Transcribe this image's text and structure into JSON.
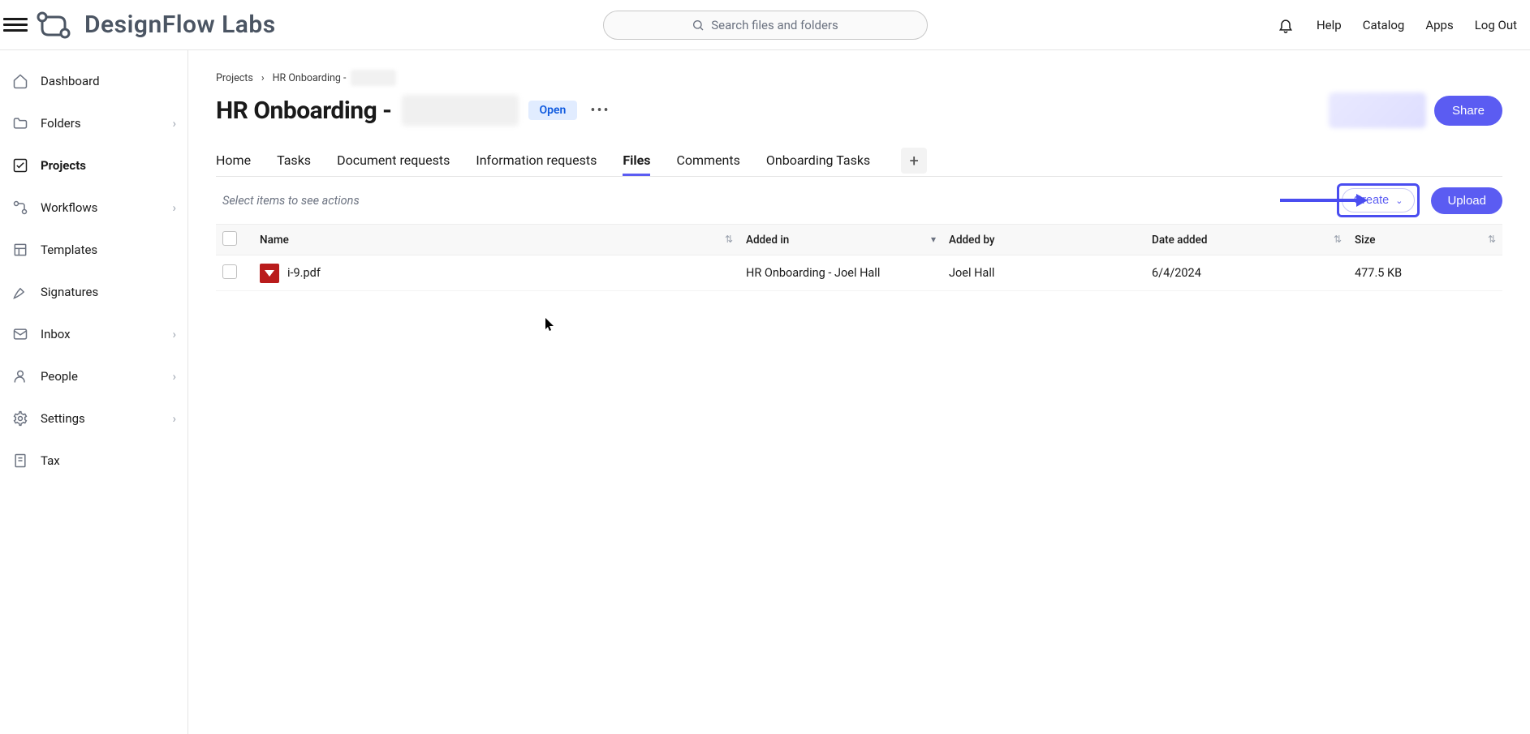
{
  "brand": {
    "name": "DesignFlow Labs"
  },
  "search": {
    "placeholder": "Search files and folders"
  },
  "topnav": {
    "help": "Help",
    "catalog": "Catalog",
    "apps": "Apps",
    "logout": "Log Out"
  },
  "sidebar": {
    "items": [
      {
        "label": "Dashboard",
        "has_chevron": false
      },
      {
        "label": "Folders",
        "has_chevron": true
      },
      {
        "label": "Projects",
        "has_chevron": false
      },
      {
        "label": "Workflows",
        "has_chevron": true
      },
      {
        "label": "Templates",
        "has_chevron": false
      },
      {
        "label": "Signatures",
        "has_chevron": false
      },
      {
        "label": "Inbox",
        "has_chevron": true
      },
      {
        "label": "People",
        "has_chevron": true
      },
      {
        "label": "Settings",
        "has_chevron": true
      },
      {
        "label": "Tax",
        "has_chevron": false
      }
    ],
    "active_index": 2
  },
  "breadcrumb": {
    "root": "Projects",
    "current": "HR Onboarding -"
  },
  "header": {
    "title": "HR Onboarding -",
    "status": "Open",
    "share": "Share"
  },
  "tabs": {
    "items": [
      "Home",
      "Tasks",
      "Document requests",
      "Information requests",
      "Files",
      "Comments",
      "Onboarding Tasks"
    ],
    "active_index": 4
  },
  "actions": {
    "hint": "Select items to see actions",
    "create": "Create",
    "upload": "Upload"
  },
  "table": {
    "columns": {
      "name": "Name",
      "added_in": "Added in",
      "added_by": "Added by",
      "date_added": "Date added",
      "size": "Size"
    },
    "rows": [
      {
        "name": "i-9.pdf",
        "added_in": "HR Onboarding - Joel Hall",
        "added_by": "Joel Hall",
        "date_added": "6/4/2024",
        "size": "477.5 KB"
      }
    ]
  }
}
